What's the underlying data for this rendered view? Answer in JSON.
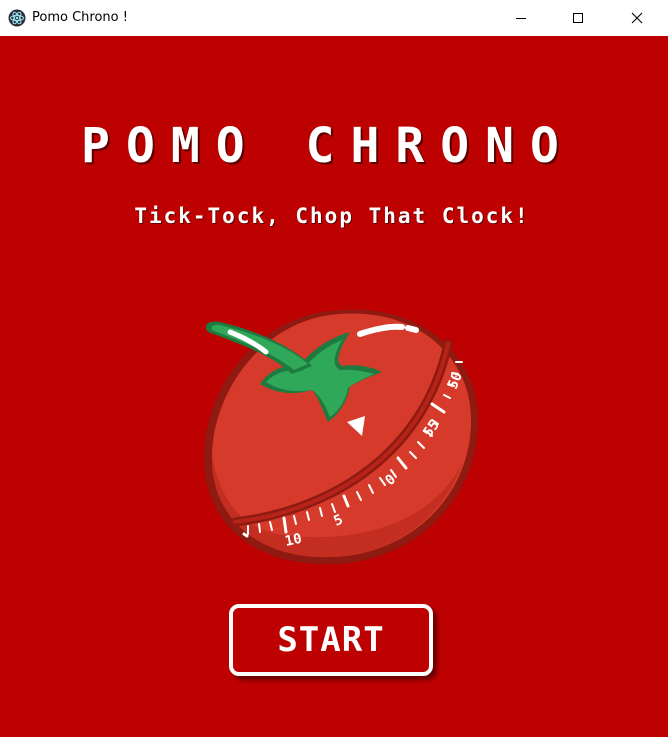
{
  "window": {
    "title": "Pomo Chrono !",
    "controls": {
      "minimize": "minimize-icon",
      "maximize": "maximize-icon",
      "close": "close-icon"
    }
  },
  "app": {
    "title": "POMO CHRONO",
    "tagline": "Tick-Tock, Chop That Clock!",
    "start_label": "START"
  },
  "timer": {
    "icon": "tomato-timer-icon",
    "dial_labels": [
      "10",
      "5",
      "0",
      "55",
      "50"
    ]
  },
  "colors": {
    "background": "#bd0000",
    "tomato": "#d63a2a",
    "tomato_dark": "#a8261b",
    "leaf": "#2fa85a",
    "leaf_dark": "#1e7a3f",
    "text": "#ffffff"
  }
}
